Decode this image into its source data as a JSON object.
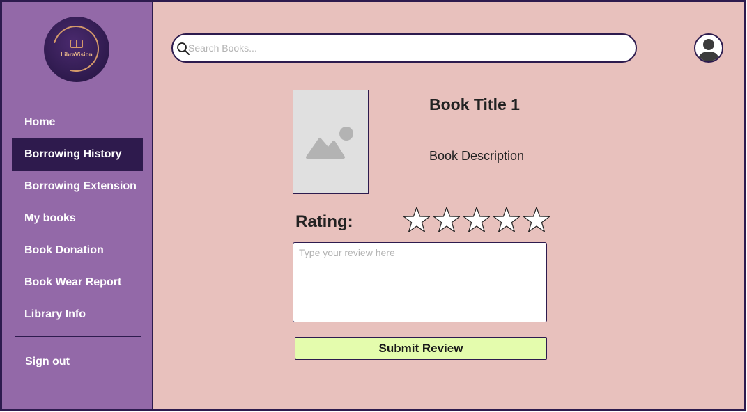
{
  "app": {
    "logo_text": "LibraVision"
  },
  "sidebar": {
    "items": [
      {
        "label": "Home"
      },
      {
        "label": "Borrowing History"
      },
      {
        "label": "Borrowing Extension"
      },
      {
        "label": "My books"
      },
      {
        "label": "Book Donation"
      },
      {
        "label": "Book Wear Report"
      },
      {
        "label": "Library Info"
      }
    ],
    "active_index": 1,
    "signout_label": "Sign out"
  },
  "header": {
    "search": {
      "placeholder": "Search Books...",
      "value": "",
      "icon": "search-icon"
    },
    "avatar_icon": "user-avatar-icon"
  },
  "book": {
    "title": "Book Title 1",
    "description": "Book Description",
    "cover_icon": "image-placeholder-icon"
  },
  "review": {
    "rating_label": "Rating:",
    "rating_value": 0,
    "rating_max": 5,
    "placeholder": "Type your review here",
    "value": "",
    "submit_label": "Submit Review"
  },
  "colors": {
    "sidebar_bg": "#9369a8",
    "active_item_bg": "#2e1a4d",
    "main_bg": "#e8c1bd",
    "submit_bg": "#e4fcad",
    "border": "#2d1b4e"
  }
}
